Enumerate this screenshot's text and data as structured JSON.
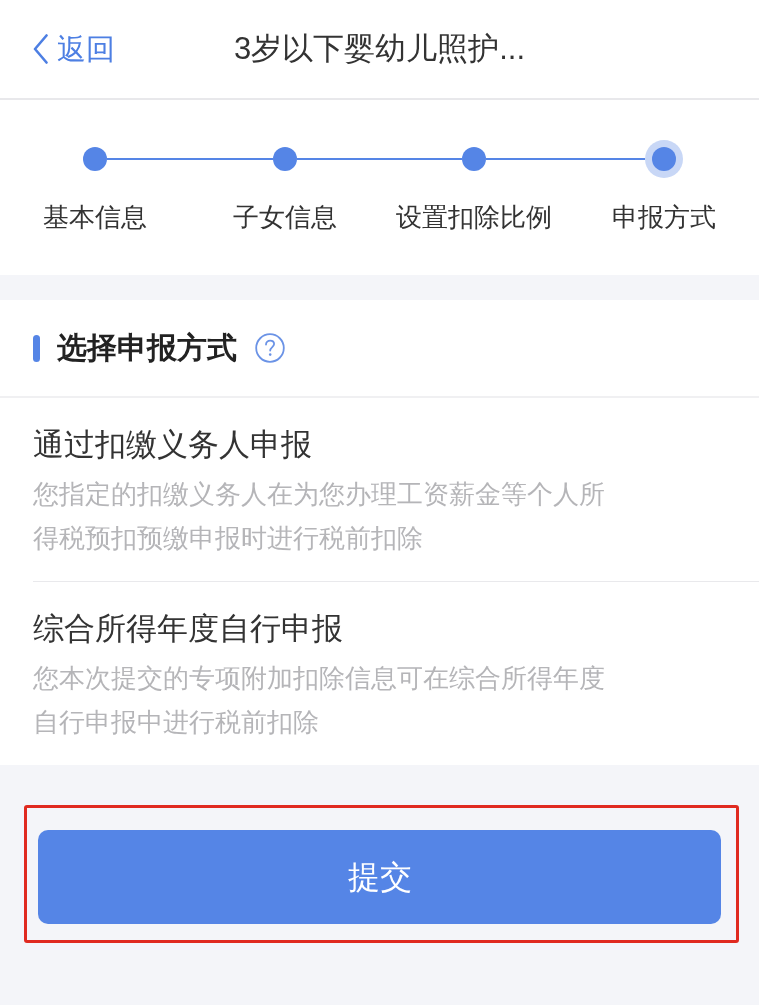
{
  "header": {
    "back": "返回",
    "title": "3岁以下婴幼儿照护..."
  },
  "steps": [
    {
      "label": "基本信息",
      "current": false
    },
    {
      "label": "子女信息",
      "current": false
    },
    {
      "label": "设置扣除比例",
      "current": false
    },
    {
      "label": "申报方式",
      "current": true
    }
  ],
  "section": {
    "title": "选择申报方式",
    "options": [
      {
        "title": "通过扣缴义务人申报",
        "description": "您指定的扣缴义务人在为您办理工资薪金等个人所得税预扣预缴申报时进行税前扣除"
      },
      {
        "title": "综合所得年度自行申报",
        "description": "您本次提交的专项附加扣除信息可在综合所得年度自行申报中进行税前扣除"
      }
    ]
  },
  "submit": {
    "label": "提交",
    "highlighted": true
  }
}
